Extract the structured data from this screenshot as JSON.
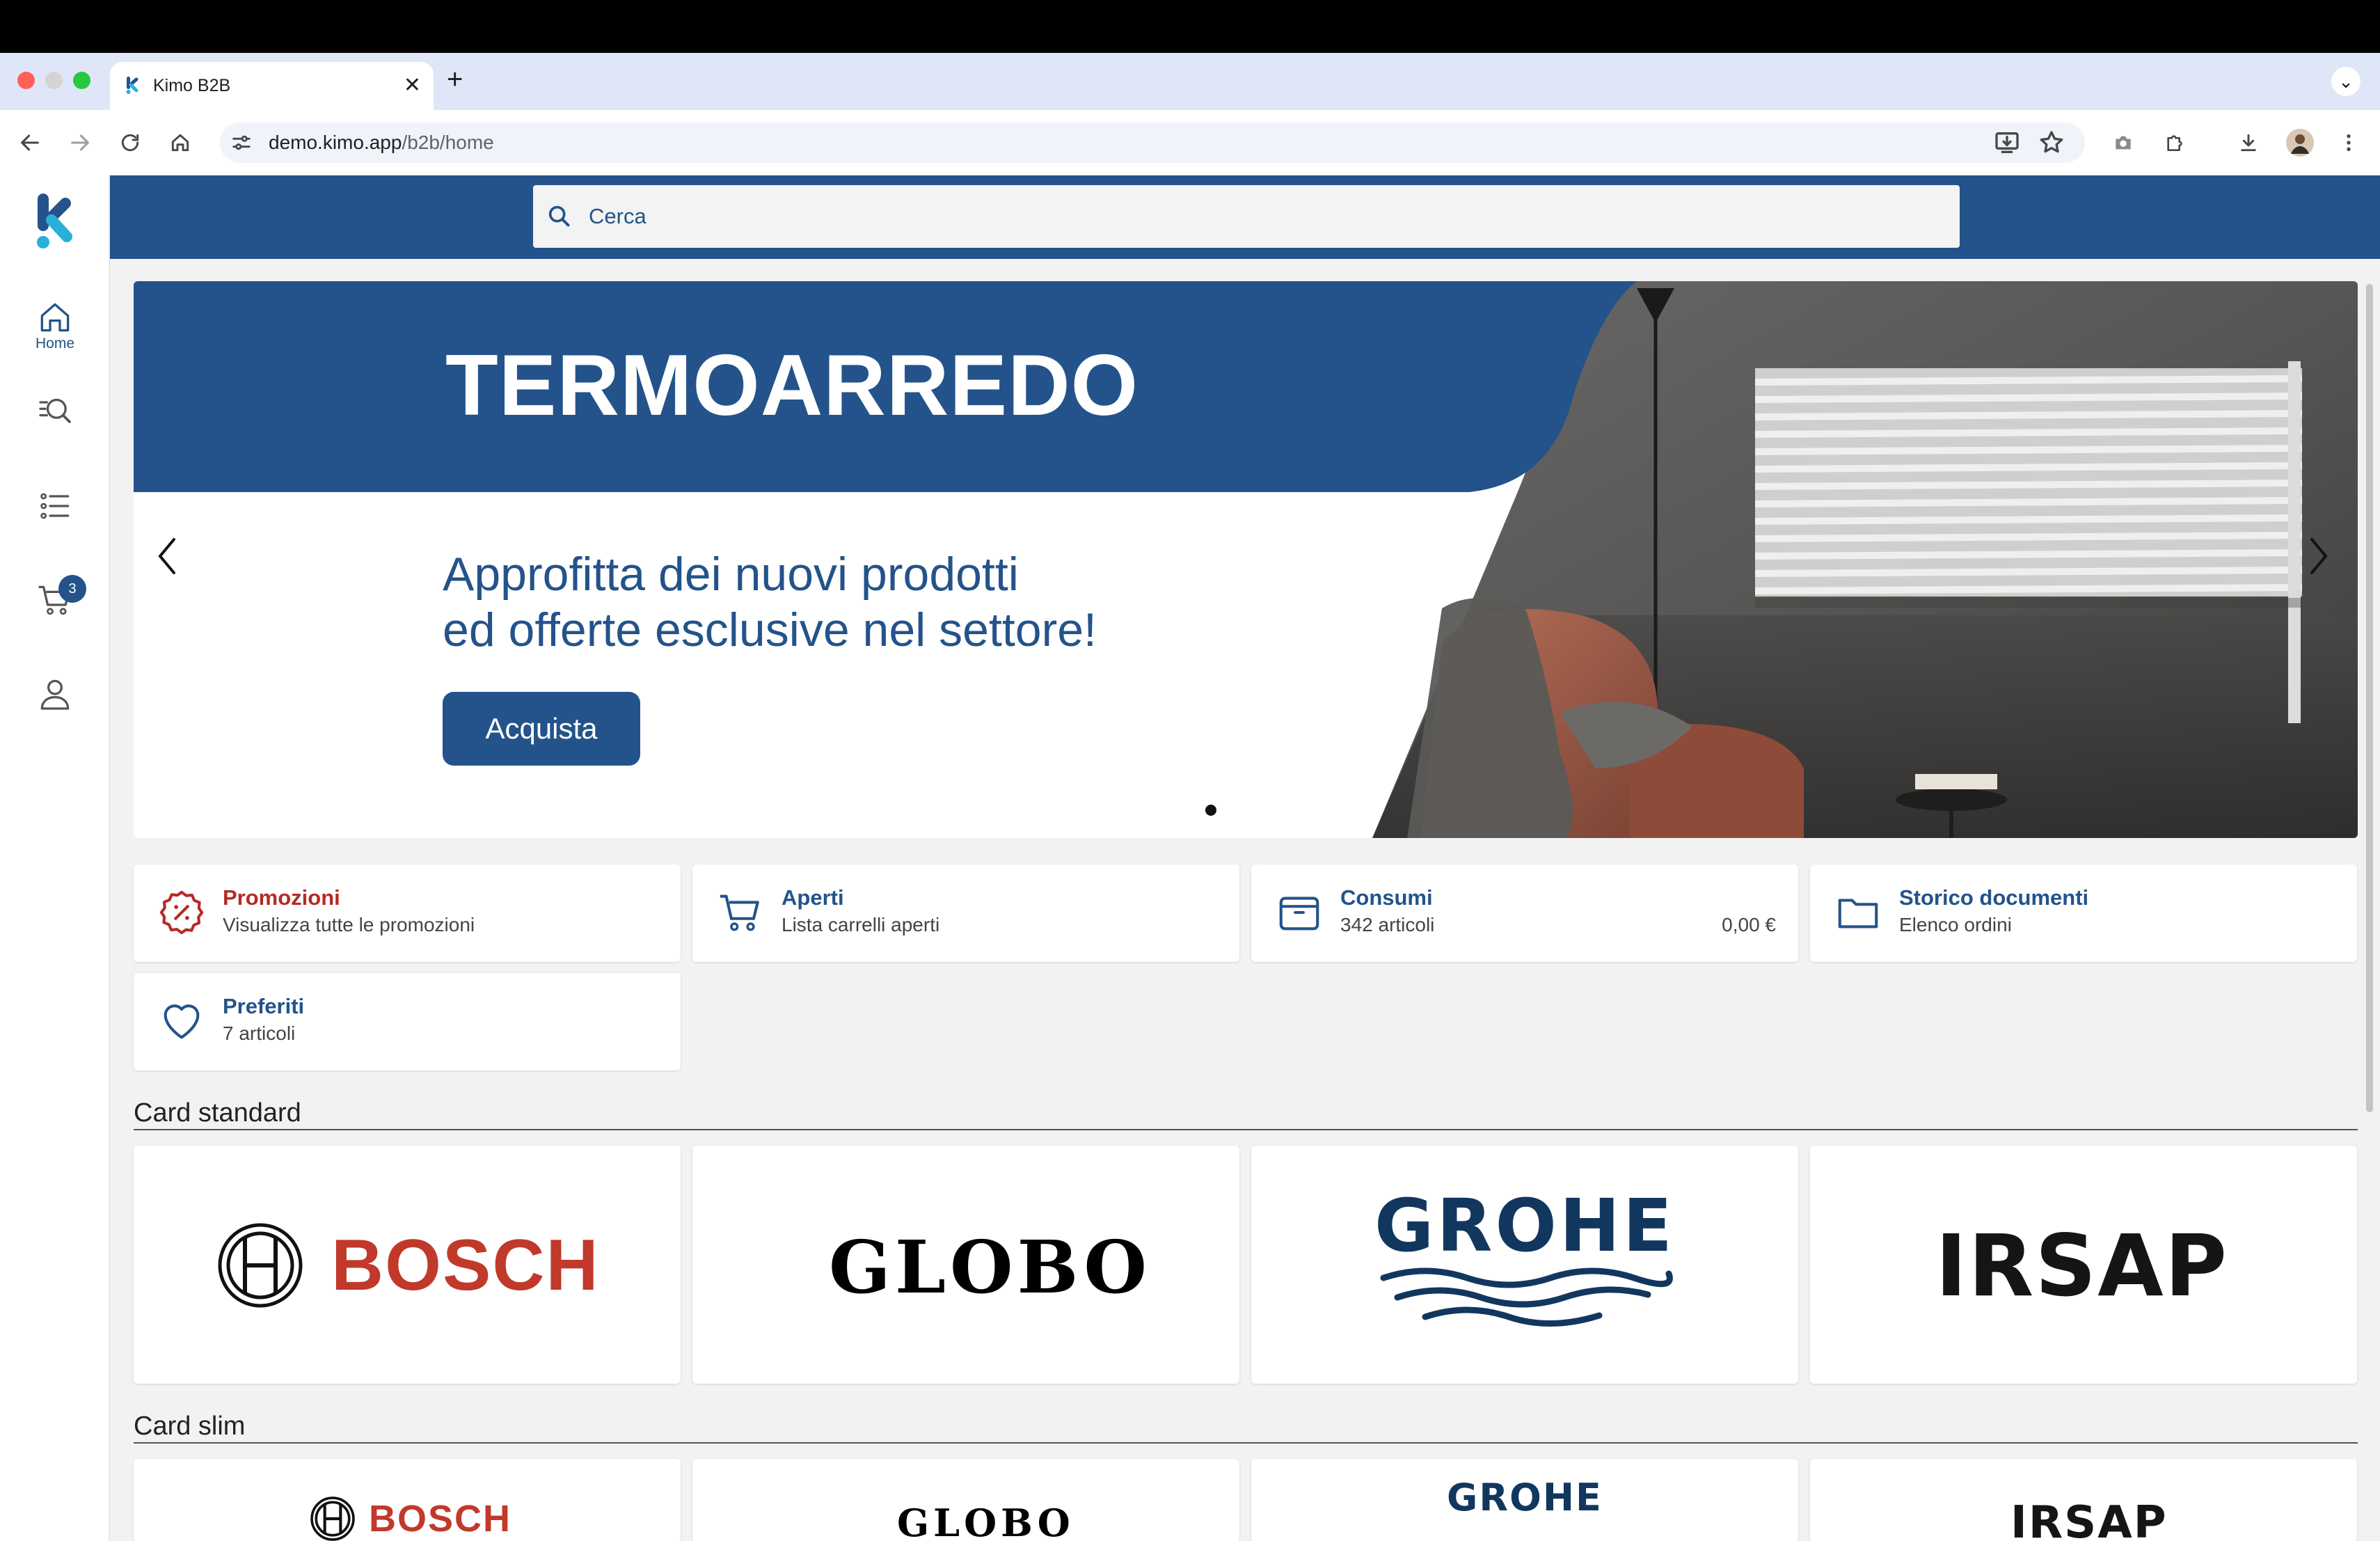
{
  "browser": {
    "tab_title": "Kimo B2B",
    "tab_close": "✕",
    "new_tab": "+",
    "tab_menu": "⌄",
    "url_host": "demo.kimo.app",
    "url_path": "/b2b/home"
  },
  "sidebar": {
    "home_label": "Home",
    "cart_count": "3"
  },
  "search": {
    "placeholder": "Cerca"
  },
  "banner": {
    "title": "TERMOARREDO",
    "subtitle_line1": "Approfitta dei nuovi prodotti",
    "subtitle_line2": "ed offerte esclusive nel settore!",
    "cta_label": "Acquista"
  },
  "quick_cards": {
    "promozioni": {
      "title": "Promozioni",
      "subtitle": "Visualizza tutte le promozioni"
    },
    "aperti": {
      "title": "Aperti",
      "subtitle": "Lista carrelli aperti"
    },
    "consumi": {
      "title": "Consumi",
      "subtitle": "342 articoli",
      "value": "0,00 €"
    },
    "storico": {
      "title": "Storico documenti",
      "subtitle": "Elenco ordini"
    },
    "preferiti": {
      "title": "Preferiti",
      "subtitle": "7 articoli"
    }
  },
  "sections": {
    "standard": "Card standard",
    "slim": "Card slim"
  },
  "brands": [
    "BOSCH",
    "GLOBO",
    "GROHE",
    "IRSAP"
  ],
  "colors": {
    "primary": "#23538a",
    "promo_red": "#b72a24",
    "bosch_red": "#c0392b",
    "grohe_blue": "#12375f"
  }
}
